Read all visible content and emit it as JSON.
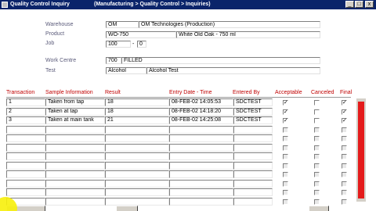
{
  "window": {
    "title": "Quality Control Inquiry",
    "path": "(Manufacturing > Quality Control > Inquiries)",
    "minimize_glyph": "_",
    "maximize_glyph": "□",
    "close_glyph": "x"
  },
  "header": {
    "warehouse_label": "Warehouse",
    "warehouse_code": "OM",
    "warehouse_name": "OM Technologies (Production)",
    "product_label": "Product",
    "product_code": "WO-750",
    "product_name": "White Old Oak - 750 ml",
    "job_label": "Job",
    "job_number": "100",
    "job_sep": "-",
    "job_sub": "0",
    "work_centre_label": "Work Centre",
    "work_centre_code": "700",
    "work_centre_name": "FILLED",
    "test_label": "Test",
    "test_code": "Alcohol",
    "test_name": "Alcohol Test"
  },
  "columns": {
    "transaction": "Transaction",
    "sample": "Sample Information",
    "result": "Result",
    "entry_date": "Entry Date - Time",
    "entered_by": "Entered By",
    "acceptable": "Acceptable",
    "canceled": "Canceled",
    "final": "Final"
  },
  "rows": [
    {
      "transaction": "1",
      "sample": "Taken from tap",
      "result": "18",
      "entry_date": "08-FEB-02 14:05:53",
      "entered_by": "SDCTEST",
      "acceptable": "✓",
      "canceled": "",
      "final": "✓"
    },
    {
      "transaction": "2",
      "sample": "Taken at tap",
      "result": "18",
      "entry_date": "08-FEB-02 14:18:20",
      "entered_by": "SDCTEST",
      "acceptable": "✓",
      "canceled": "",
      "final": "✓"
    },
    {
      "transaction": "3",
      "sample": "Taken at main tank",
      "result": "21",
      "entry_date": "08-FEB-02 14:25:08",
      "entered_by": "SDCTEST",
      "acceptable": "✓",
      "canceled": "",
      "final": "✓"
    },
    {
      "transaction": "",
      "sample": "",
      "result": "",
      "entry_date": "",
      "entered_by": "",
      "acceptable": "",
      "canceled": "",
      "final": ""
    },
    {
      "transaction": "",
      "sample": "",
      "result": "",
      "entry_date": "",
      "entered_by": "",
      "acceptable": "",
      "canceled": "",
      "final": ""
    },
    {
      "transaction": "",
      "sample": "",
      "result": "",
      "entry_date": "",
      "entered_by": "",
      "acceptable": "",
      "canceled": "",
      "final": ""
    },
    {
      "transaction": "",
      "sample": "",
      "result": "",
      "entry_date": "",
      "entered_by": "",
      "acceptable": "",
      "canceled": "",
      "final": ""
    },
    {
      "transaction": "",
      "sample": "",
      "result": "",
      "entry_date": "",
      "entered_by": "",
      "acceptable": "",
      "canceled": "",
      "final": ""
    },
    {
      "transaction": "",
      "sample": "",
      "result": "",
      "entry_date": "",
      "entered_by": "",
      "acceptable": "",
      "canceled": "",
      "final": ""
    },
    {
      "transaction": "",
      "sample": "",
      "result": "",
      "entry_date": "",
      "entered_by": "",
      "acceptable": "",
      "canceled": "",
      "final": ""
    },
    {
      "transaction": "",
      "sample": "",
      "result": "",
      "entry_date": "",
      "entered_by": "",
      "acceptable": "",
      "canceled": "",
      "final": ""
    },
    {
      "transaction": "",
      "sample": "",
      "result": "",
      "entry_date": "",
      "entered_by": "",
      "acceptable": "",
      "canceled": "",
      "final": ""
    }
  ],
  "colors": {
    "titlebar": "#0a246a",
    "column_header": "#c00000",
    "scrollbar_thumb": "#e41b1b",
    "cursor_highlight": "#f7f00a"
  }
}
